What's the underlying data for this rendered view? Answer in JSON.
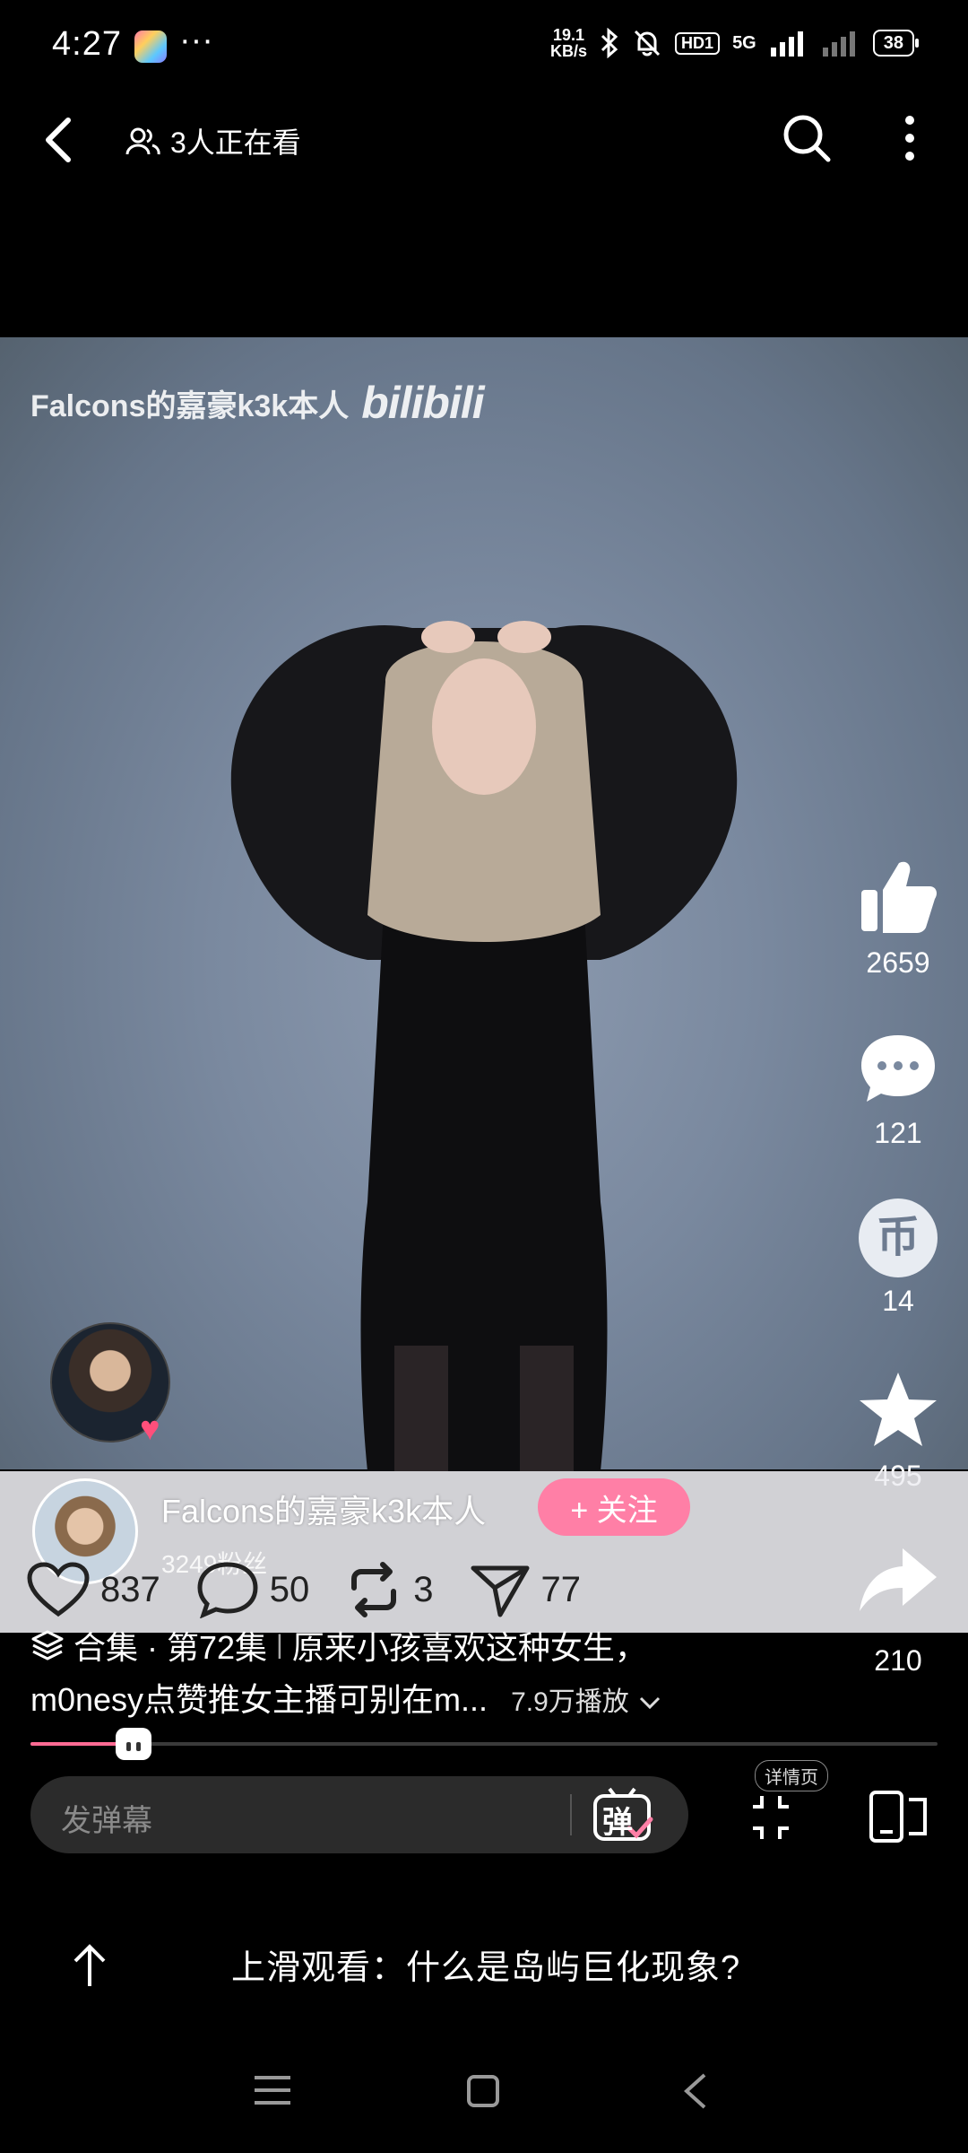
{
  "status_bar": {
    "time": "4:27",
    "more": "···",
    "net_speed_value": "19.1",
    "net_speed_unit": "KB/s",
    "hd_badge": "HD1",
    "network": "5G",
    "battery": "38"
  },
  "top_bar": {
    "watching_text": "3人正在看"
  },
  "video": {
    "watermark_text": "Falcons的嘉豪k3k本人",
    "watermark_logo": "bilibili"
  },
  "rail": {
    "like_count": "2659",
    "comment_count": "121",
    "coin_count": "14",
    "coin_glyph": "币",
    "favorite_count": "495",
    "share_count": "210"
  },
  "uploader": {
    "name": "Falcons的嘉豪k3k本人",
    "follow_label": "+ 关注",
    "fans": "3249粉丝"
  },
  "stats": {
    "like": "837",
    "comment": "50",
    "repost": "3",
    "send": "77"
  },
  "title": {
    "collection": "合集 · 第72集",
    "separator": "|",
    "line1_rest": "原来小孩喜欢这种女生，",
    "line2": "m0nesy点赞推女主播可别在m...",
    "views": "7.9万播放"
  },
  "progress": {
    "played_fraction": 0.05
  },
  "danmaku": {
    "placeholder": "发弹幕",
    "toggle_label": "弹",
    "detail_label": "详情页"
  },
  "next": {
    "text": "上滑观看：什么是岛屿巨化现象?"
  },
  "colors": {
    "accent_pink": "#ff7fa6",
    "progress_pink": "#ff6b93",
    "heart_red": "#ff4f7b"
  }
}
